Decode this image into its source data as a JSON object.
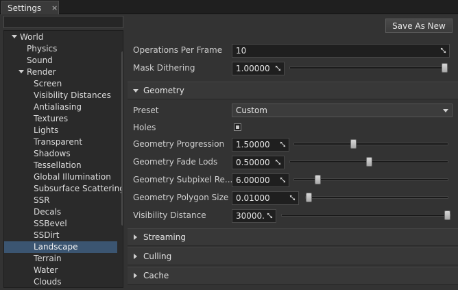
{
  "window": {
    "tab_title": "Settings",
    "tab_close": "×"
  },
  "sidebar": {
    "search_placeholder": "",
    "items": [
      {
        "label": "World",
        "expanded": true
      },
      {
        "label": "Physics"
      },
      {
        "label": "Sound"
      },
      {
        "label": "Render",
        "expanded": true
      },
      {
        "label": "Screen"
      },
      {
        "label": "Visibility Distances"
      },
      {
        "label": "Antialiasing"
      },
      {
        "label": "Textures"
      },
      {
        "label": "Lights"
      },
      {
        "label": "Transparent"
      },
      {
        "label": "Shadows"
      },
      {
        "label": "Tessellation"
      },
      {
        "label": "Global Illumination"
      },
      {
        "label": "Subsurface Scattering"
      },
      {
        "label": "SSR"
      },
      {
        "label": "Decals"
      },
      {
        "label": "SSBevel"
      },
      {
        "label": "SSDirt"
      },
      {
        "label": "Landscape",
        "selected": true
      },
      {
        "label": "Terrain"
      },
      {
        "label": "Water"
      },
      {
        "label": "Clouds"
      }
    ]
  },
  "toolbar": {
    "save_as_new": "Save As New"
  },
  "properties": {
    "operations_per_frame": {
      "label": "Operations Per Frame",
      "value": "10"
    },
    "mask_dithering": {
      "label": "Mask Dithering",
      "value": "1.00000",
      "slider": 1.0
    }
  },
  "geometry": {
    "title": "Geometry",
    "preset": {
      "label": "Preset",
      "value": "Custom"
    },
    "holes": {
      "label": "Holes",
      "checked": true
    },
    "progression": {
      "label": "Geometry Progression",
      "value": "1.50000",
      "slider": 0.38
    },
    "fade_lods": {
      "label": "Geometry Fade Lods",
      "value": "0.50000",
      "slider": 0.5
    },
    "subpixel": {
      "label": "Geometry Subpixel Re...",
      "value": "6.00000",
      "slider": 0.14
    },
    "polygon_size": {
      "label": "Geometry Polygon Size",
      "value": "0.01000",
      "slider": 0.0
    },
    "visibility_distance": {
      "label": "Visibility Distance",
      "value": "30000.",
      "slider": 1.0
    }
  },
  "sections": {
    "streaming": "Streaming",
    "culling": "Culling",
    "cache": "Cache"
  },
  "colors": {
    "background": "#333333",
    "selection": "#3b5571",
    "field": "#1f1f1f"
  }
}
